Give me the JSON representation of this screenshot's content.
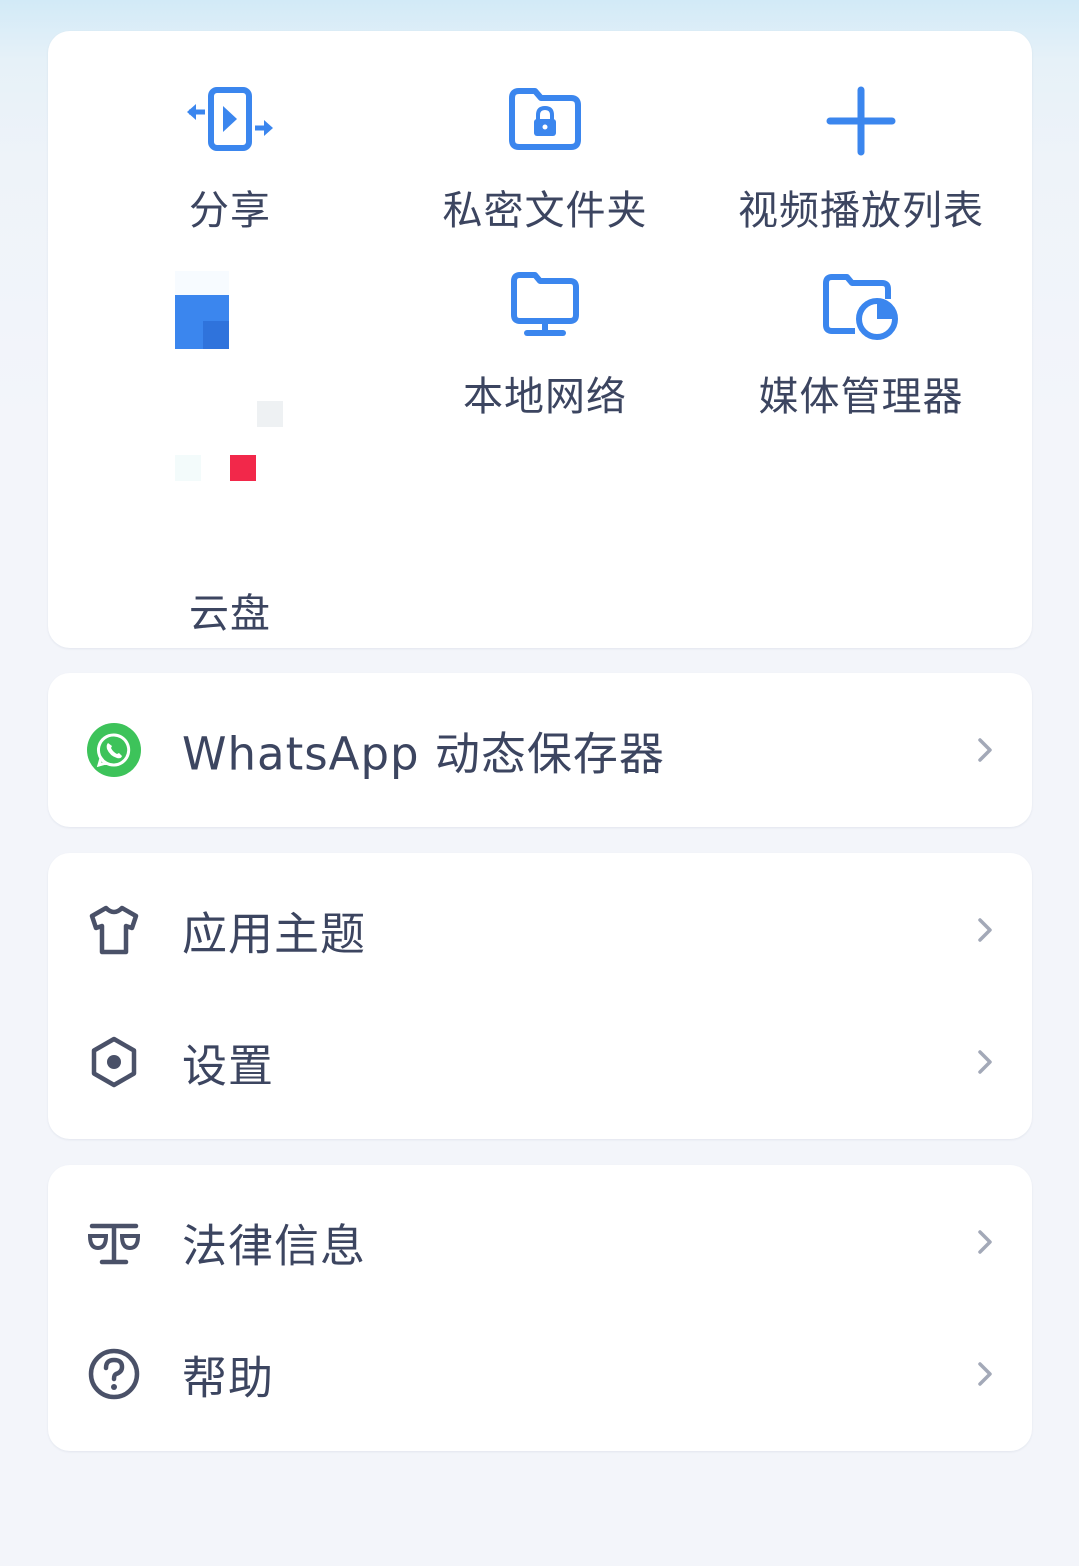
{
  "colors": {
    "accent": "#3b86ee",
    "text": "#3c4560",
    "icon_dark": "#4a5168",
    "chevron": "#a3a9b8",
    "whatsapp": "#3dc35a",
    "card": "#ffffff"
  },
  "tools": [
    {
      "label": "分享",
      "icon": "share-transfer-icon"
    },
    {
      "label": "私密文件夹",
      "icon": "private-folder-icon"
    },
    {
      "label": "视频播放列表",
      "icon": "add-playlist-icon"
    },
    {
      "label": "云盘",
      "icon": "cloud-drive-icon"
    },
    {
      "label": "本地网络",
      "icon": "local-network-icon"
    },
    {
      "label": "媒体管理器",
      "icon": "media-manager-icon"
    }
  ],
  "whatsapp": {
    "label": "WhatsApp 动态保存器",
    "icon": "whatsapp-icon"
  },
  "settings_group": [
    {
      "label": "应用主题",
      "icon": "tshirt-icon"
    },
    {
      "label": "设置",
      "icon": "settings-hex-icon"
    }
  ],
  "info_group": [
    {
      "label": "法律信息",
      "icon": "scale-icon"
    },
    {
      "label": "帮助",
      "icon": "help-icon"
    }
  ]
}
